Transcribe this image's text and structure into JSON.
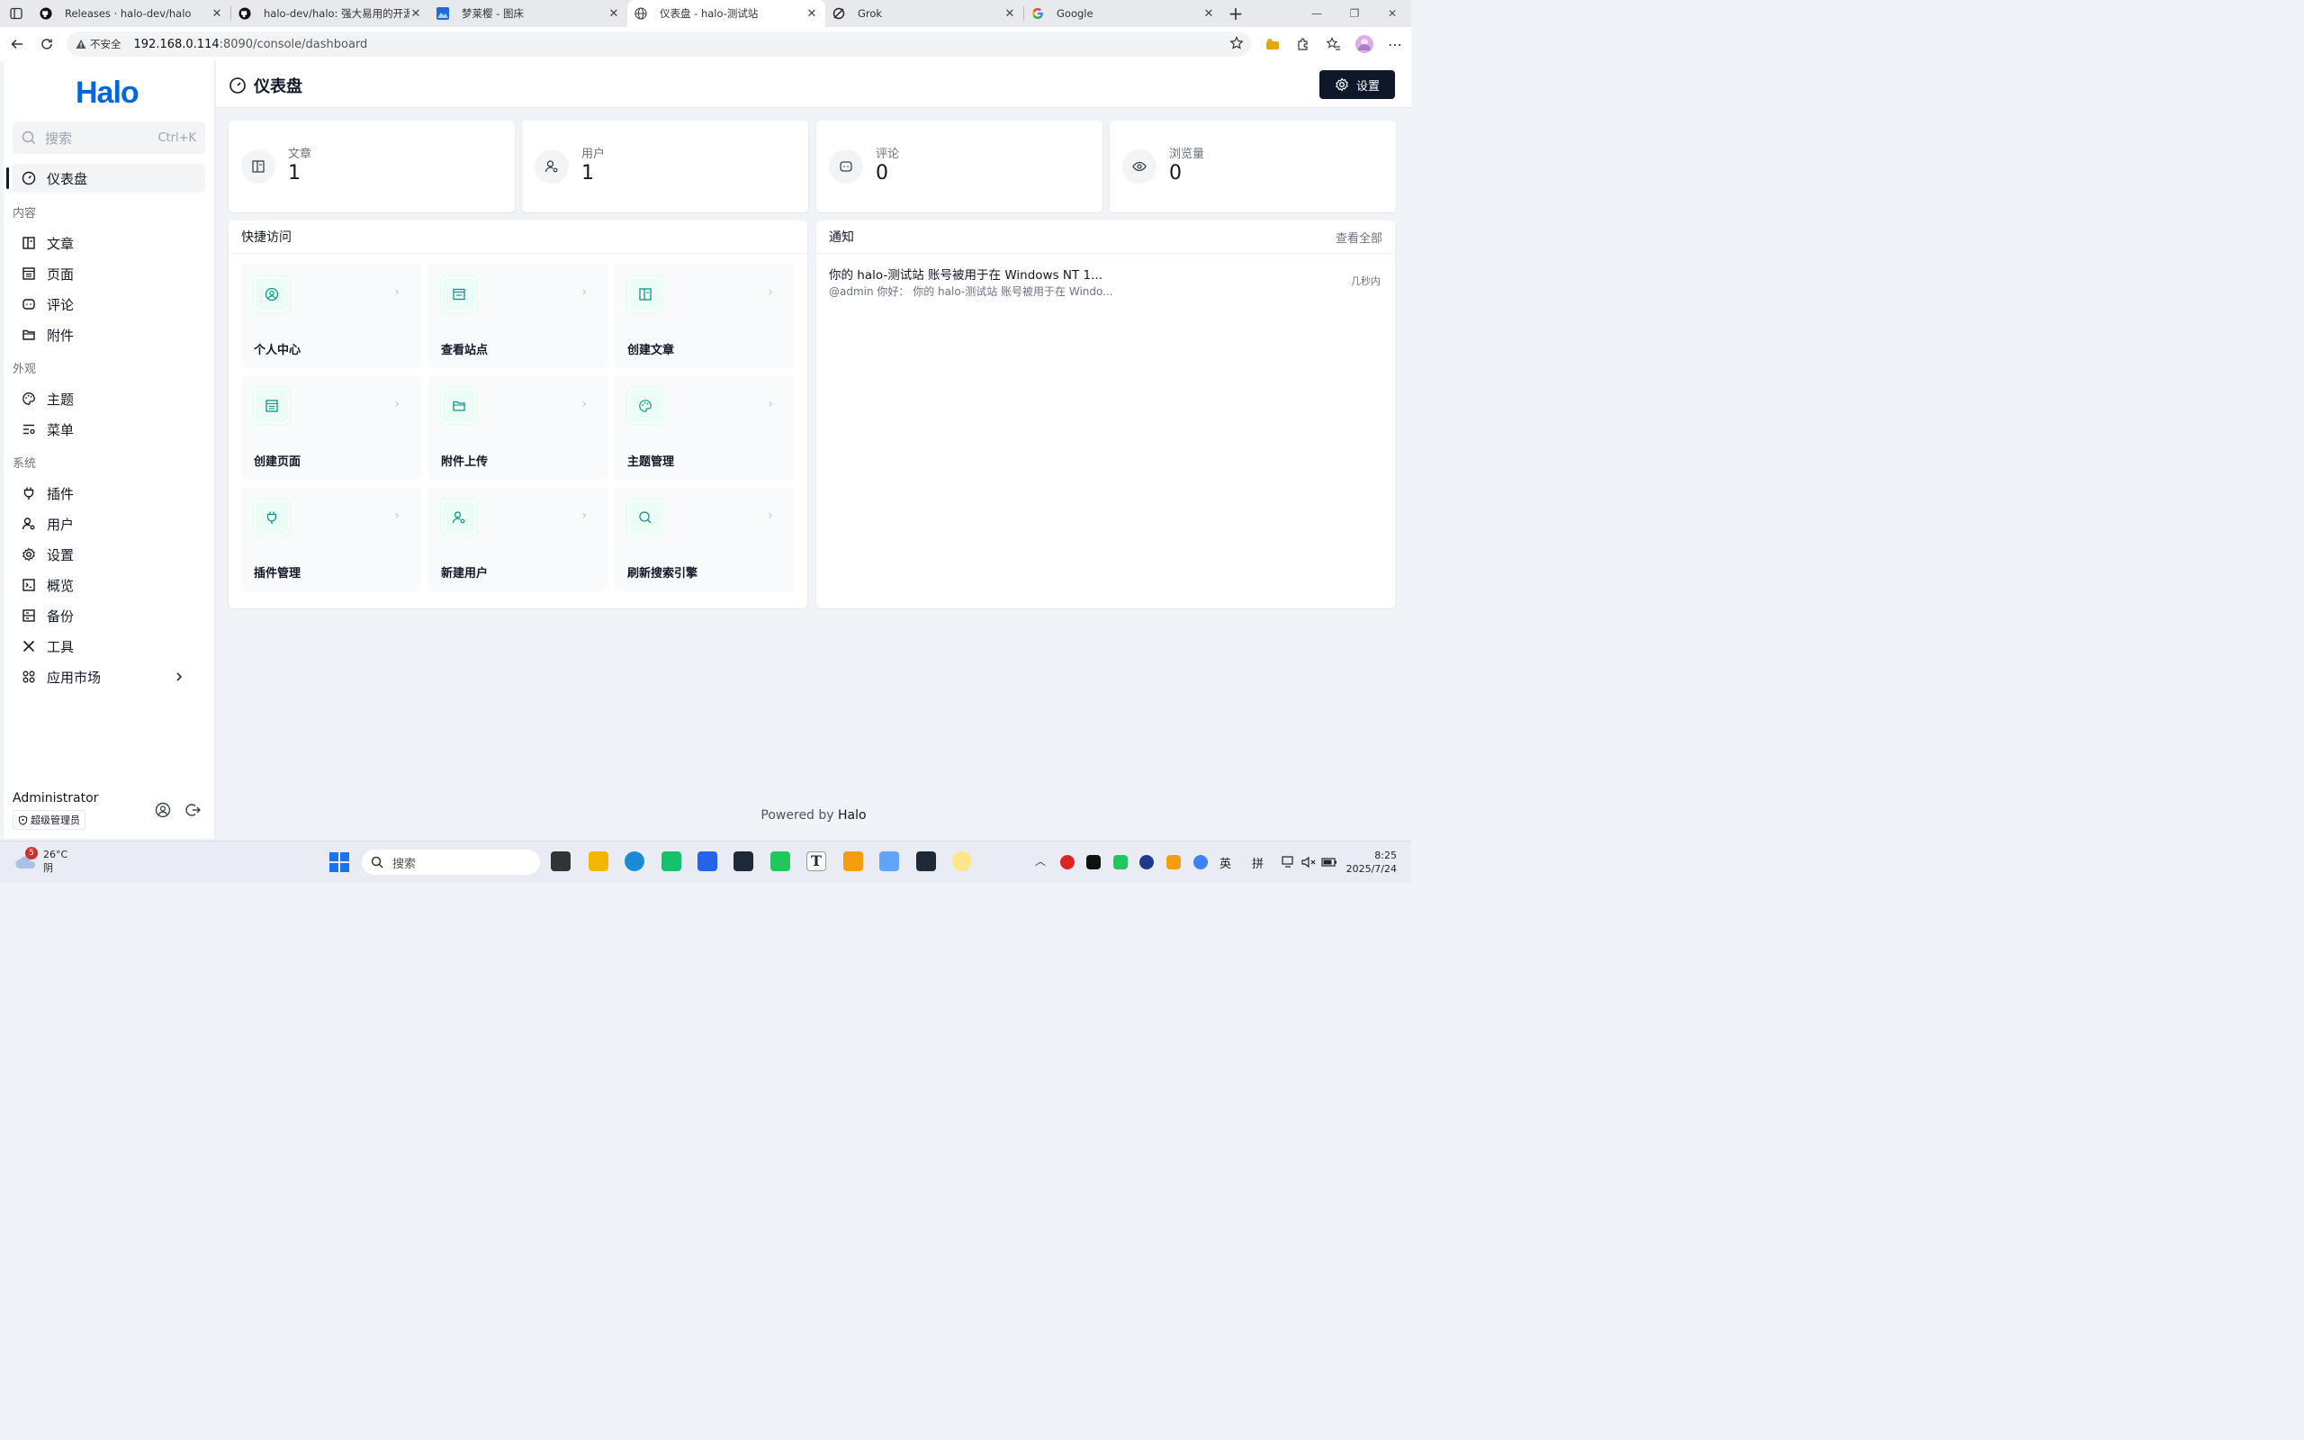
{
  "browser": {
    "tabs": [
      {
        "title": "Releases · halo-dev/halo",
        "icon": "github-icon"
      },
      {
        "title": "halo-dev/halo: 强大易用的开源建",
        "icon": "github-icon"
      },
      {
        "title": "梦莱樱 - 图床",
        "icon": "image-icon"
      },
      {
        "title": "仪表盘 - halo-测试站",
        "icon": "globe-icon",
        "active": true
      },
      {
        "title": "Grok",
        "icon": "grok-icon"
      },
      {
        "title": "Google",
        "icon": "google-icon"
      }
    ],
    "insecure_label": "不安全",
    "url_host": "192.168.0.114",
    "url_rest": ":8090/console/dashboard"
  },
  "app": {
    "logo": "Halo",
    "search_placeholder": "搜索",
    "search_shortcut": "Ctrl+K",
    "nav": {
      "dashboard": "仪表盘",
      "group_content": "内容",
      "posts": "文章",
      "pages": "页面",
      "comments": "评论",
      "attachments": "附件",
      "group_appearance": "外观",
      "themes": "主题",
      "menus": "菜单",
      "group_system": "系统",
      "plugins": "插件",
      "users": "用户",
      "settings": "设置",
      "overview": "概览",
      "backup": "备份",
      "tools": "工具",
      "app_market": "应用市场"
    },
    "user": {
      "name": "Administrator",
      "role": "超级管理员"
    },
    "page_title": "仪表盘",
    "settings_button": "设置",
    "stats": [
      {
        "label": "文章",
        "value": "1",
        "icon": "post-icon"
      },
      {
        "label": "用户",
        "value": "1",
        "icon": "user-gear-icon"
      },
      {
        "label": "评论",
        "value": "0",
        "icon": "comment-icon"
      },
      {
        "label": "浏览量",
        "value": "0",
        "icon": "eye-icon"
      }
    ],
    "quick_access": {
      "title": "快捷访问",
      "items": [
        {
          "label": "个人中心",
          "icon": "user-circle-icon"
        },
        {
          "label": "查看站点",
          "icon": "browser-icon"
        },
        {
          "label": "创建文章",
          "icon": "post-icon"
        },
        {
          "label": "创建页面",
          "icon": "page-icon"
        },
        {
          "label": "附件上传",
          "icon": "folder-icon"
        },
        {
          "label": "主题管理",
          "icon": "palette-icon"
        },
        {
          "label": "插件管理",
          "icon": "plug-icon"
        },
        {
          "label": "新建用户",
          "icon": "user-gear-icon"
        },
        {
          "label": "刷新搜索引擎",
          "icon": "search-icon"
        }
      ]
    },
    "notifications": {
      "title": "通知",
      "view_all": "查看全部",
      "items": [
        {
          "title": "你的 halo-测试站 账号被用于在 Windows NT 1...",
          "summary": "@admin 你好： 你的 halo-测试站 账号被用于在 Windo...",
          "time": "几秒内"
        }
      ]
    },
    "footer_prefix": "Powered by ",
    "footer_brand": "Halo"
  },
  "taskbar": {
    "weather_temp": "26°C",
    "weather_desc": "阴",
    "weather_badge": "5",
    "search_placeholder": "搜索",
    "ime_lang": "英",
    "ime_mode": "拼",
    "time": "8:25",
    "date": "2025/7/24"
  },
  "colors": {
    "accent": "#0f172a",
    "quick_icon": "#0d9488",
    "logo": "#0066dd"
  }
}
